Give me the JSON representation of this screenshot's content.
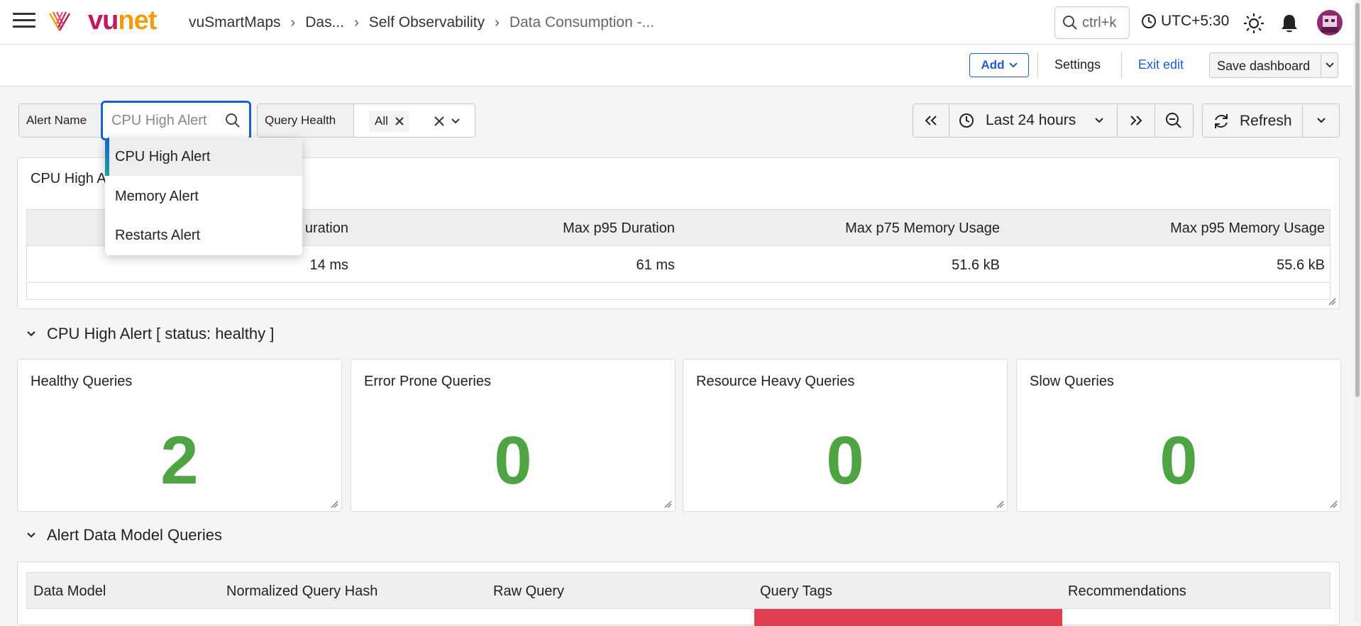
{
  "brand": {
    "vu": "vu",
    "net": "net"
  },
  "breadcrumbs": [
    "vuSmartMaps",
    "Das...",
    "Self Observability",
    "Data Consumption -..."
  ],
  "search": {
    "shortcut": "ctrl+k"
  },
  "timezone": "UTC+5:30",
  "toolbar": {
    "add_label": "Add",
    "settings_label": "Settings",
    "exit_label": "Exit edit",
    "save_label": "Save dashboard"
  },
  "filters": {
    "alert_name": {
      "label": "Alert Name",
      "placeholder": "CPU High Alert"
    },
    "query_health": {
      "label": "Query Health",
      "chip": "All"
    }
  },
  "time": {
    "range": "Last 24 hours",
    "refresh_label": "Refresh"
  },
  "dropdown_options": [
    "CPU High Alert",
    "Memory Alert",
    "Restarts Alert"
  ],
  "summary_panel": {
    "title": "CPU High A",
    "columns": [
      "uration",
      "Max p95 Duration",
      "Max p75 Memory Usage",
      "Max p95 Memory Usage"
    ],
    "row": [
      "14 ms",
      "61 ms",
      "51.6 kB",
      "55.6 kB"
    ]
  },
  "section_status": "CPU High Alert [ status: healthy ]",
  "stat_cards": [
    {
      "title": "Healthy Queries",
      "value": "2"
    },
    {
      "title": "Error Prone Queries",
      "value": "0"
    },
    {
      "title": "Resource Heavy Queries",
      "value": "0"
    },
    {
      "title": "Slow Queries",
      "value": "0"
    }
  ],
  "section_queries": "Alert Data Model Queries",
  "queries_table": {
    "columns": [
      "Data Model",
      "Normalized Query Hash",
      "Raw Query",
      "Query Tags",
      "Recommendations"
    ]
  },
  "colors": {
    "accent": "#1a5fd0",
    "stat_green": "#4ea343",
    "tag_red": "#e04050"
  }
}
